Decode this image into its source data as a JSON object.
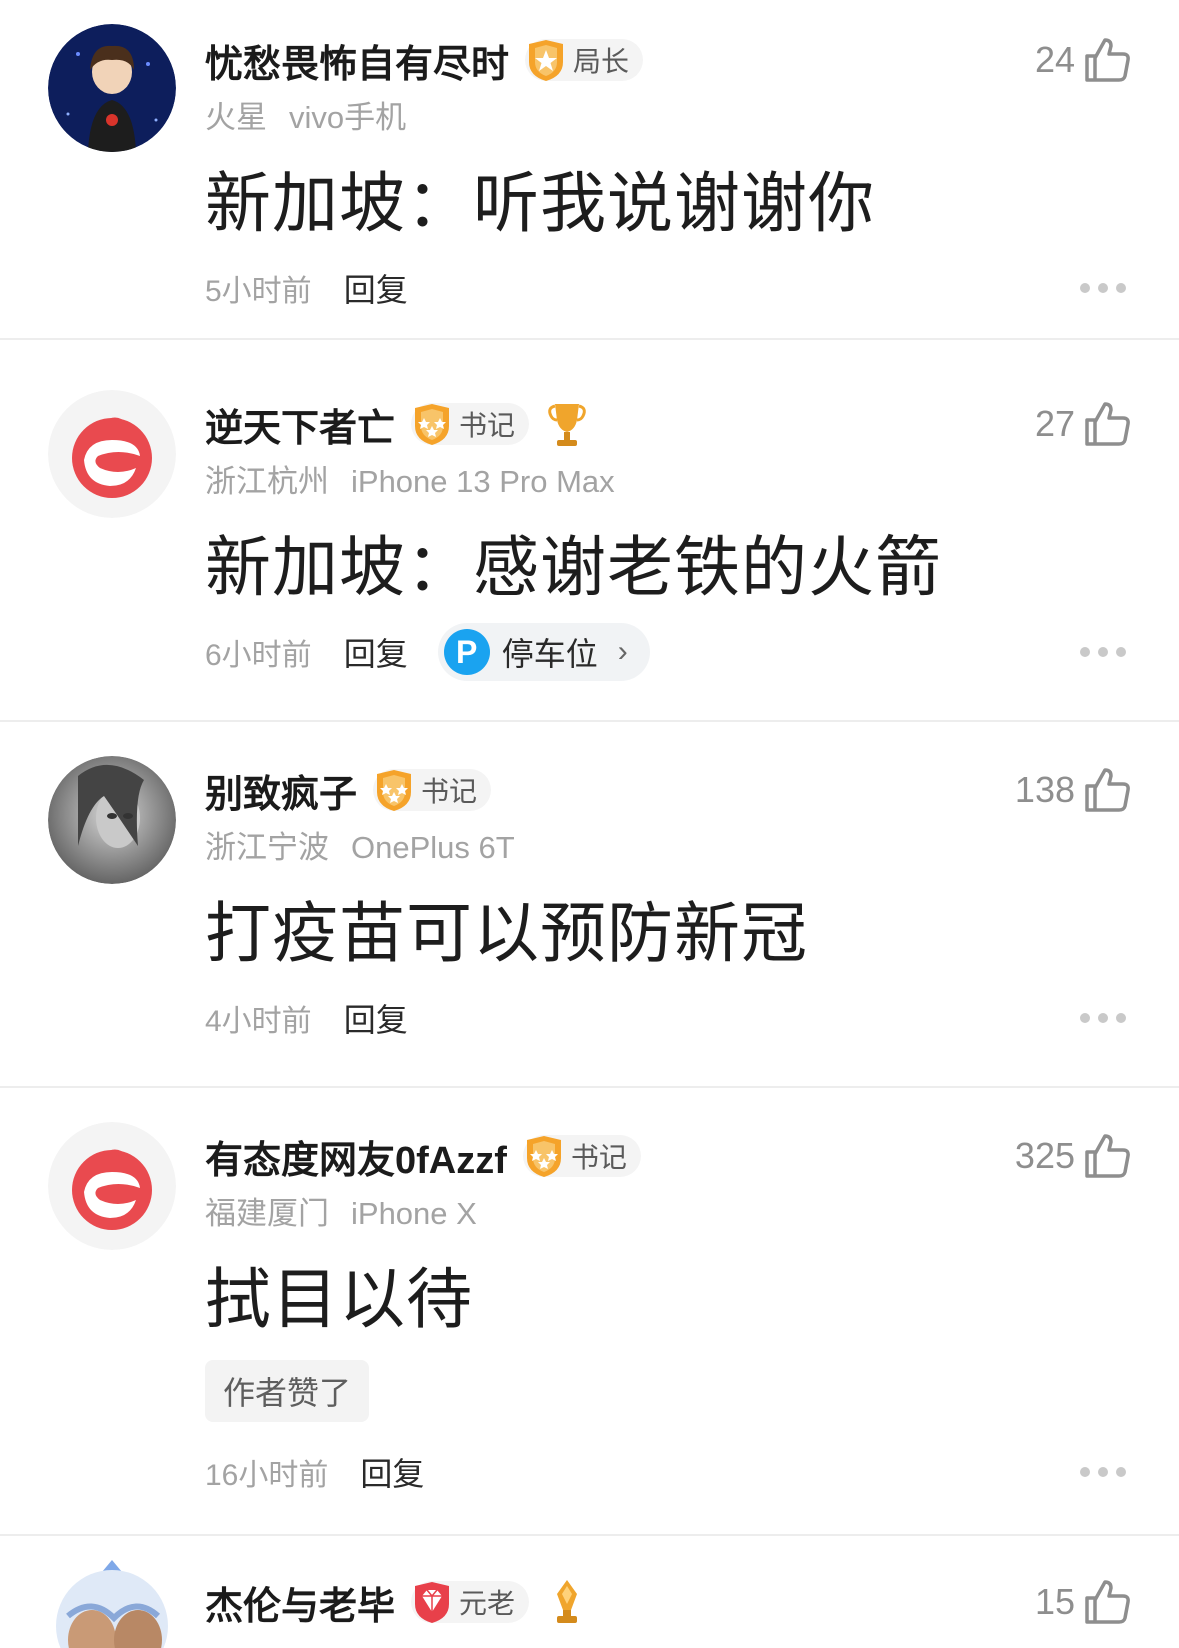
{
  "comments": [
    {
      "username": "忧愁畏怖自有尽时",
      "badge": "局长",
      "location": "火星",
      "device": "vivo手机",
      "content": "新加坡：听我说谢谢你",
      "time": "5小时前",
      "reply": "回复",
      "likes": "24"
    },
    {
      "username": "逆天下者亡",
      "badge": "书记",
      "location": "浙江杭州",
      "device": "iPhone 13 Pro Max",
      "content": "新加坡：感谢老铁的火箭",
      "time": "6小时前",
      "reply": "回复",
      "likes": "27",
      "parking": {
        "icon": "P",
        "label": "停车位"
      }
    },
    {
      "username": "别致疯子",
      "badge": "书记",
      "location": "浙江宁波",
      "device": "OnePlus 6T",
      "content": "打疫苗可以预防新冠",
      "time": "4小时前",
      "reply": "回复",
      "likes": "138"
    },
    {
      "username": "有态度网友0fAzzf",
      "badge": "书记",
      "location": "福建厦门",
      "device": "iPhone X",
      "content": "拭目以待",
      "author_liked": "作者赞了",
      "time": "16小时前",
      "reply": "回复",
      "likes": "325"
    },
    {
      "username": "杰伦与老毕",
      "badge": "元老",
      "likes": "15"
    }
  ],
  "colors": {
    "badge_orange": "#f5a32a",
    "badge_red": "#e8404a",
    "avatar_red": "#e94a4f",
    "parking_blue": "#1aa3f0"
  }
}
